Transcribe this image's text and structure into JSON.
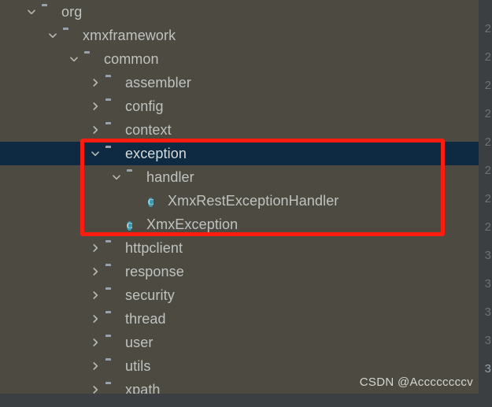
{
  "panel": {
    "name": "project-tree",
    "background_color": "#4d4a41",
    "selection_color": "#0d2a42",
    "folder_icon_color": "#97a0ad",
    "class_icon_color": "#3c9ab0",
    "text_color": "#bfc3c0"
  },
  "tree": {
    "rows": [
      {
        "label": "org",
        "depth": 2,
        "icon": "folder-icon",
        "arrow": "chevron-down-icon",
        "selected": false
      },
      {
        "label": "xmxframework",
        "depth": 3,
        "icon": "folder-icon",
        "arrow": "chevron-down-icon",
        "selected": false
      },
      {
        "label": "common",
        "depth": 4,
        "icon": "folder-icon",
        "arrow": "chevron-down-icon",
        "selected": false
      },
      {
        "label": "assembler",
        "depth": 5,
        "icon": "folder-icon",
        "arrow": "chevron-right-icon",
        "selected": false
      },
      {
        "label": "config",
        "depth": 5,
        "icon": "folder-icon",
        "arrow": "chevron-right-icon",
        "selected": false
      },
      {
        "label": "context",
        "depth": 5,
        "icon": "folder-icon",
        "arrow": "chevron-right-icon",
        "selected": false
      },
      {
        "label": "exception",
        "depth": 5,
        "icon": "folder-icon",
        "arrow": "chevron-down-icon",
        "selected": true
      },
      {
        "label": "handler",
        "depth": 6,
        "icon": "folder-icon",
        "arrow": "chevron-down-icon",
        "selected": false
      },
      {
        "label": "XmxRestExceptionHandler",
        "depth": 7,
        "icon": "java-class-icon",
        "arrow": "none",
        "selected": false
      },
      {
        "label": "XmxException",
        "depth": 6,
        "icon": "java-class-icon",
        "arrow": "none",
        "selected": false
      },
      {
        "label": "httpclient",
        "depth": 5,
        "icon": "folder-icon",
        "arrow": "chevron-right-icon",
        "selected": false
      },
      {
        "label": "response",
        "depth": 5,
        "icon": "folder-icon",
        "arrow": "chevron-right-icon",
        "selected": false
      },
      {
        "label": "security",
        "depth": 5,
        "icon": "folder-icon",
        "arrow": "chevron-right-icon",
        "selected": false
      },
      {
        "label": "thread",
        "depth": 5,
        "icon": "folder-icon",
        "arrow": "chevron-right-icon",
        "selected": false
      },
      {
        "label": "user",
        "depth": 5,
        "icon": "folder-icon",
        "arrow": "chevron-right-icon",
        "selected": false
      },
      {
        "label": "utils",
        "depth": 5,
        "icon": "folder-icon",
        "arrow": "chevron-right-icon",
        "selected": false
      },
      {
        "label": "xpath",
        "depth": 5,
        "icon": "folder-icon",
        "arrow": "chevron-right-icon",
        "selected": false
      }
    ]
  },
  "annotation": {
    "name": "red-highlight-box",
    "color": "#fd1d10",
    "encloses": [
      "exception",
      "handler",
      "XmxRestExceptionHandler",
      "XmxException"
    ]
  },
  "class_icon_letter": "C",
  "editor_gutter": {
    "visible_digits": [
      "2",
      "2",
      "2",
      "2",
      "2",
      "2",
      "2",
      "2",
      "3",
      "3",
      "3",
      "3",
      "3"
    ]
  },
  "watermark": {
    "text": "CSDN @Accccccccv"
  },
  "bottom_strip": {
    "ghost_text": ""
  }
}
